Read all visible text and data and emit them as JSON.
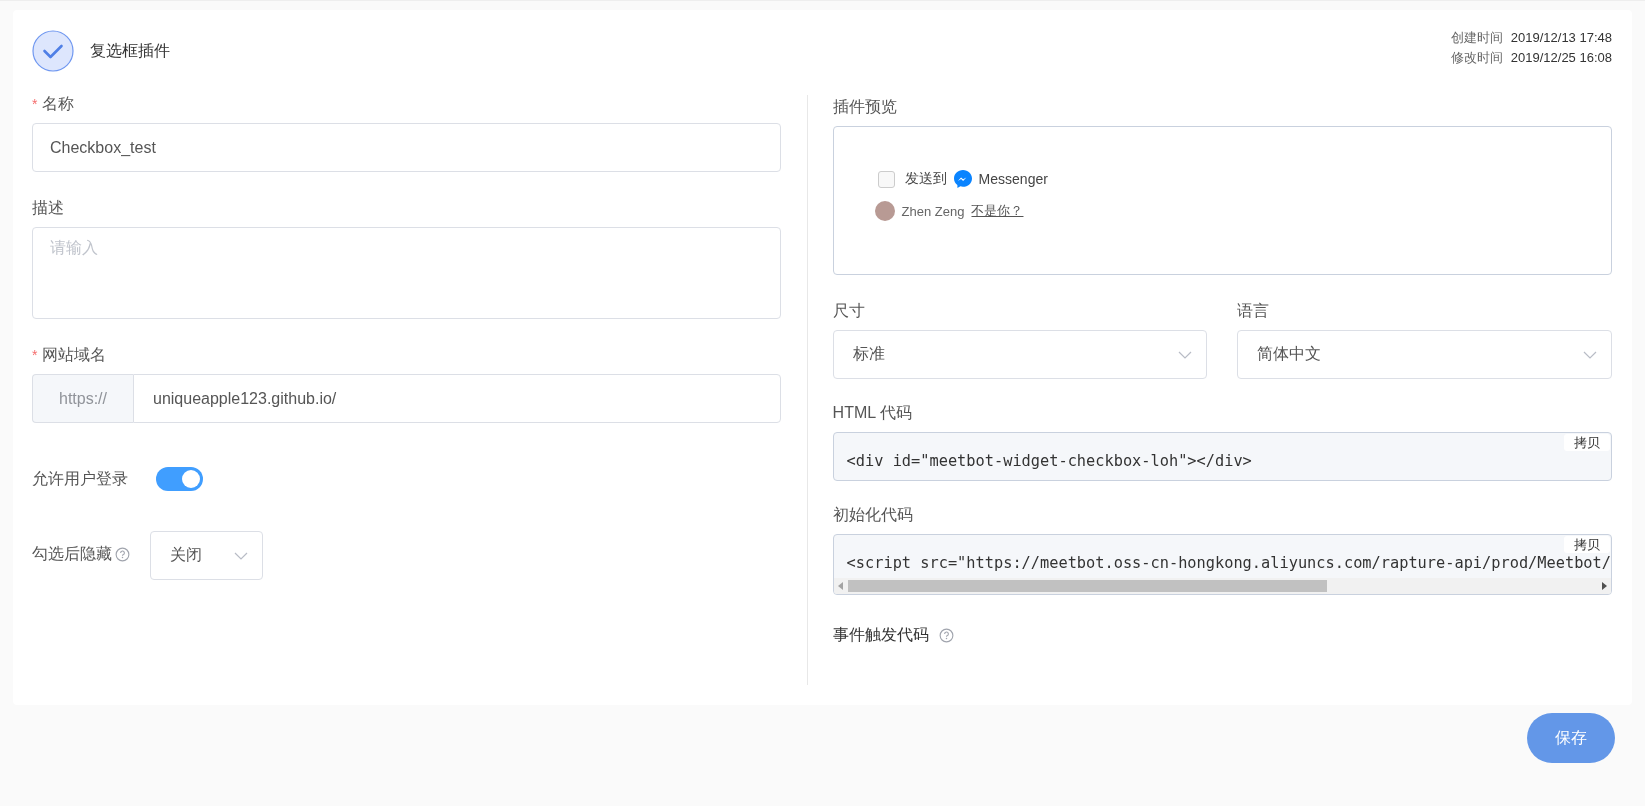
{
  "header": {
    "title": "复选框插件",
    "meta": [
      {
        "label": "创建时间",
        "value": "2019/12/13 17:48"
      },
      {
        "label": "修改时间",
        "value": "2019/12/25 16:08"
      }
    ]
  },
  "form": {
    "fields": [
      {
        "kind": "text",
        "label": "名称",
        "required_mark": "*",
        "value": "Checkbox_test"
      },
      {
        "kind": "textarea",
        "label": "描述",
        "placeholder": "请输入"
      },
      {
        "kind": "url",
        "label": "网站域名",
        "required_mark": "*",
        "prefix": "https://",
        "value": "uniqueapple123.github.io/"
      },
      {
        "kind": "switch",
        "label": "允许用户登录",
        "on": true
      },
      {
        "kind": "select",
        "label": "勾选后隐藏",
        "help": true,
        "value": "关闭"
      }
    ]
  },
  "preview": {
    "label": "插件预览",
    "checkbox": {
      "checked": false,
      "text": "发送到",
      "brand": "Messenger"
    },
    "user": {
      "name": "Zhen Zeng",
      "link": "不是你？"
    }
  },
  "selects": [
    {
      "label": "尺寸",
      "value": "标准"
    },
    {
      "label": "语言",
      "value": "简体中文"
    }
  ],
  "code_blocks": [
    {
      "label": "HTML 代码",
      "code": "<div id=\"meetbot-widget-checkbox-loh\"></div>",
      "copy": "拷贝",
      "scrollbar": false
    },
    {
      "label": "初始化代码",
      "code": "<script src=\"https://meetbot.oss-cn-hongkong.aliyuncs.com/rapture-api/prod/Meetbot/",
      "copy": "拷贝",
      "scrollbar": true
    }
  ],
  "event_code": {
    "label": "事件触发代码",
    "help": true
  },
  "save_button": "保存"
}
